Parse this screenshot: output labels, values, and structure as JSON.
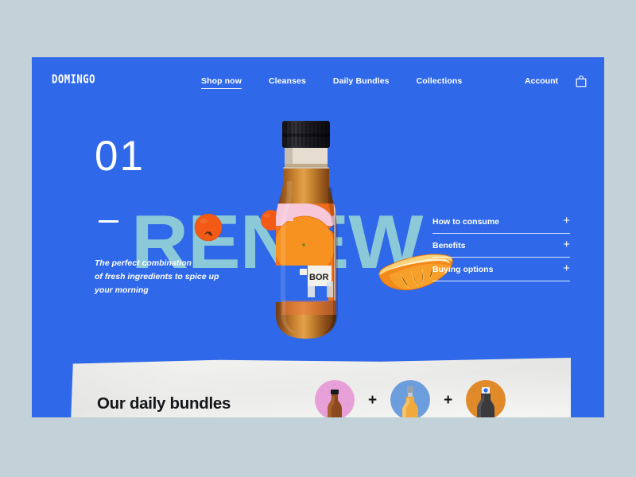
{
  "brand": {
    "logo": "DOMINGO"
  },
  "nav": {
    "links": [
      {
        "label": "Shop now",
        "active": true
      },
      {
        "label": "Cleanses",
        "active": false
      },
      {
        "label": "Daily Bundles",
        "active": false
      },
      {
        "label": "Collections",
        "active": false
      }
    ],
    "account_label": "Account",
    "bag_icon": "shopping-bag-icon"
  },
  "hero": {
    "slide_number": "01",
    "wordmark": "RENEW",
    "tagline": "The perfect combination of fresh ingredients to spice up your morning",
    "tagline_lines": [
      "The perfect combination",
      "of fresh ingredients to spice up",
      "your morning"
    ]
  },
  "accordion": {
    "items": [
      {
        "label": "How to consume",
        "toggle": "+"
      },
      {
        "label": "Benefits",
        "toggle": "+"
      },
      {
        "label": "Buying options",
        "toggle": "+"
      }
    ]
  },
  "bundles": {
    "title": "Our daily bundles",
    "separator": "+",
    "items": [
      {
        "name": "amber-bottle-product",
        "bg": "#e8a0d8",
        "bottle": "#8a4a1e"
      },
      {
        "name": "yellow-bottle-product",
        "bg": "#6c9ede",
        "bottle": "#f0a93c"
      },
      {
        "name": "dark-bottle-product",
        "bg": "#e08a2a",
        "bottle": "#3a3a3c"
      }
    ]
  },
  "colors": {
    "page_background": "#c3d1d8",
    "hero_blue": "#2f68e8",
    "wordmark_blue": "#8cc9d8",
    "paper_white": "#f1f1ef",
    "text_white": "#ffffff",
    "text_dark": "#15161a",
    "orange": "#f26a1b"
  }
}
